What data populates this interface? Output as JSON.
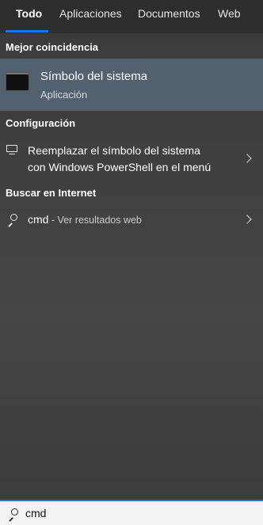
{
  "tabs": [
    {
      "label": "Todo",
      "active": true
    },
    {
      "label": "Aplicaciones"
    },
    {
      "label": "Documentos"
    },
    {
      "label": "Web"
    }
  ],
  "best_match": {
    "section_label": "Mejor coincidencia",
    "title": "Símbolo del sistema",
    "subtitle": "Aplicación",
    "icon": "terminal-icon"
  },
  "settings": {
    "section_label": "Configuración",
    "item_line1": "Reemplazar el símbolo del sistema",
    "item_line2": "con Windows PowerShell en el menú",
    "icon": "monitor-icon"
  },
  "web": {
    "section_label": "Buscar en Internet",
    "query": "cmd",
    "hint": " - Ver resultados web",
    "icon": "search-icon"
  },
  "search_box": {
    "value": "cmd",
    "icon": "search-icon"
  },
  "colors": {
    "accent": "#1a73e8",
    "selected_row": "#52616f"
  }
}
